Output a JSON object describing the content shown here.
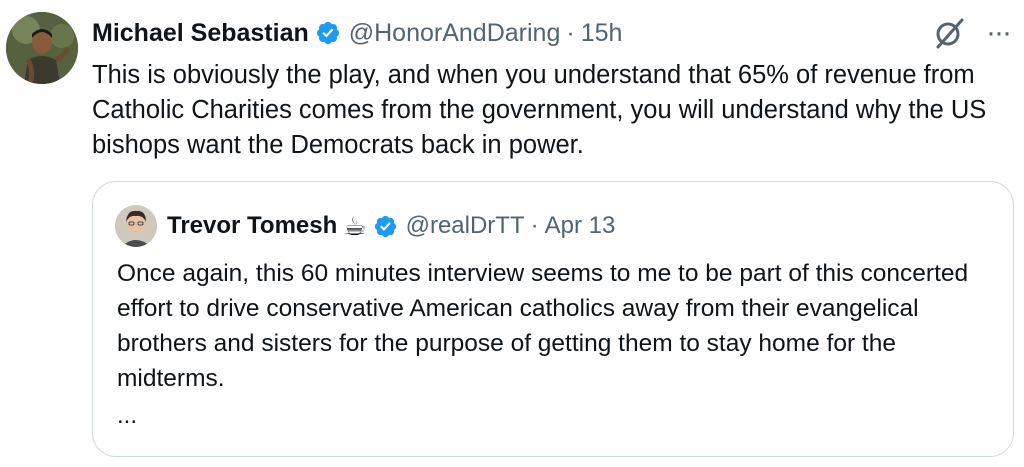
{
  "tweet": {
    "author": {
      "display_name": "Michael Sebastian",
      "handle": "@HonorAndDaring",
      "verified": true,
      "avatar_icon": "profile-photo"
    },
    "separator": "·",
    "time": "15h",
    "text": "This is obviously the play, and when you understand that 65% of revenue from Catholic Charities comes from the government, you will understand why the US bishops want the Democrats back in power.",
    "icons": {
      "grok": "grok-slash-icon",
      "more": "more-horizontal-icon"
    },
    "more_label": "···"
  },
  "quoted_tweet": {
    "author": {
      "display_name": "Trevor Tomesh",
      "emoji": "☕",
      "handle": "@realDrTT",
      "verified": true,
      "avatar_icon": "profile-photo"
    },
    "separator": "·",
    "date": "Apr 13",
    "text": "Once again, this 60 minutes interview seems to me to be part of this concerted effort to drive conservative American catholics away from their evangelical brothers and sisters for the purpose of getting them to stay home for the midterms.",
    "ellipsis": "..."
  },
  "colors": {
    "text_primary": "#0f1419",
    "text_secondary": "#536471",
    "verified_blue": "#1d9bf0",
    "border": "#cfd9de"
  }
}
